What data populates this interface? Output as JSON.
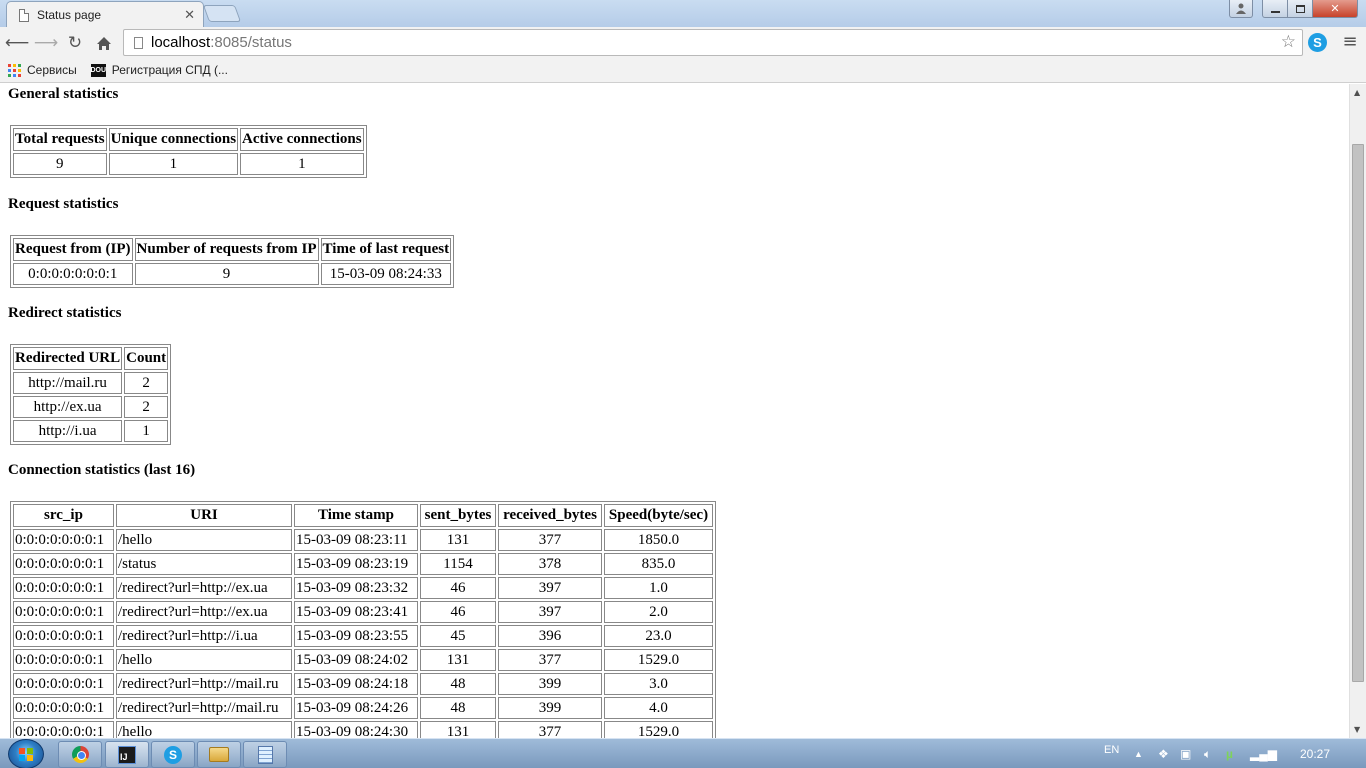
{
  "browser": {
    "tab_title": "Status page",
    "url_host": "localhost",
    "url_rest": ":8085/status",
    "bookmarks": [
      {
        "label": "Сервисы",
        "icon": "apps-grid-icon"
      },
      {
        "label": "Регистрация СПД (...",
        "icon": "dou-logo-icon"
      }
    ],
    "dou_icon_text": "DOU"
  },
  "page": {
    "general": {
      "title": "General statistics",
      "headers": [
        "Total requests",
        "Unique connections",
        "Active connections"
      ],
      "row": [
        "9",
        "1",
        "1"
      ]
    },
    "request": {
      "title": "Request statistics",
      "headers": [
        "Request from (IP)",
        "Number of requests from IP",
        "Time of last request"
      ],
      "row": [
        "0:0:0:0:0:0:0:1",
        "9",
        "15-03-09 08:24:33"
      ]
    },
    "redirect": {
      "title": "Redirect statistics",
      "headers": [
        "Redirected URL",
        "Count"
      ],
      "rows": [
        [
          "http://mail.ru",
          "2"
        ],
        [
          "http://ex.ua",
          "2"
        ],
        [
          "http://i.ua",
          "1"
        ]
      ]
    },
    "connection": {
      "title": "Connection statistics (last 16)",
      "headers": [
        "src_ip",
        "URI",
        "Time stamp",
        "sent_bytes",
        "received_bytes",
        "Speed(byte/sec)"
      ],
      "rows": [
        [
          "0:0:0:0:0:0:0:1",
          "/hello",
          "15-03-09 08:23:11",
          "131",
          "377",
          "1850.0"
        ],
        [
          "0:0:0:0:0:0:0:1",
          "/status",
          "15-03-09 08:23:19",
          "1154",
          "378",
          "835.0"
        ],
        [
          "0:0:0:0:0:0:0:1",
          "/redirect?url=http://ex.ua",
          "15-03-09 08:23:32",
          "46",
          "397",
          "1.0"
        ],
        [
          "0:0:0:0:0:0:0:1",
          "/redirect?url=http://ex.ua",
          "15-03-09 08:23:41",
          "46",
          "397",
          "2.0"
        ],
        [
          "0:0:0:0:0:0:0:1",
          "/redirect?url=http://i.ua",
          "15-03-09 08:23:55",
          "45",
          "396",
          "23.0"
        ],
        [
          "0:0:0:0:0:0:0:1",
          "/hello",
          "15-03-09 08:24:02",
          "131",
          "377",
          "1529.0"
        ],
        [
          "0:0:0:0:0:0:0:1",
          "/redirect?url=http://mail.ru",
          "15-03-09 08:24:18",
          "48",
          "399",
          "3.0"
        ],
        [
          "0:0:0:0:0:0:0:1",
          "/redirect?url=http://mail.ru",
          "15-03-09 08:24:26",
          "48",
          "399",
          "4.0"
        ],
        [
          "0:0:0:0:0:0:0:1",
          "/hello",
          "15-03-09 08:24:30",
          "131",
          "377",
          "1529.0"
        ]
      ]
    }
  },
  "taskbar": {
    "apps": [
      "chrome-icon",
      "intellij-idea-icon",
      "skype-icon",
      "explorer-folder-icon",
      "notepad-icon"
    ],
    "idea_icon_text": "IJ",
    "skype_icon_text": "S",
    "language": "EN",
    "clock": "20:27"
  },
  "colors": {
    "titlebar": "#c9dcf1",
    "toolbar": "#f2f2f2",
    "taskbar": "#7a99bd",
    "close_button": "#c7422a"
  }
}
